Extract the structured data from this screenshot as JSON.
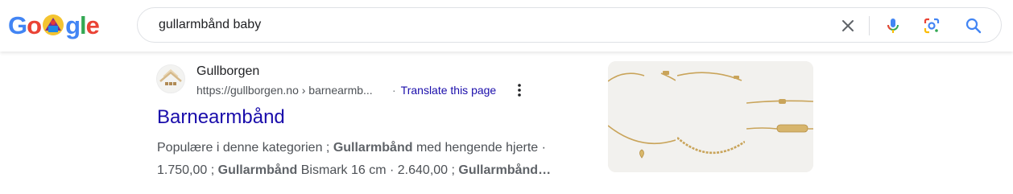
{
  "logo": {
    "alt": "Google"
  },
  "search": {
    "query": "gullarmbånd baby"
  },
  "icons": {
    "clear": "close-icon",
    "mic": "mic-icon",
    "lens": "lens-icon",
    "search": "search-icon",
    "more": "more-vert-icon"
  },
  "result": {
    "site_name": "Gullborgen",
    "url": "https://gullborgen.no › barnearmb...",
    "separator": "·",
    "translate_label": "Translate this page",
    "title": "Barnearmbånd",
    "snippet_line1": [
      {
        "text": "Populære i denne kategorien ; ",
        "bold": false
      },
      {
        "text": "Gullarmbånd",
        "bold": true
      },
      {
        "text": " med hengende hjerte ·",
        "bold": false
      }
    ],
    "snippet_line2": [
      {
        "text": "1.750,00 ; ",
        "bold": false
      },
      {
        "text": "Gullarmbånd",
        "bold": true
      },
      {
        "text": " Bismark 16 cm · 2.640,00 ; ",
        "bold": false
      },
      {
        "text": "Gullarmbånd…",
        "bold": true
      }
    ]
  },
  "colors": {
    "link": "#1a0dab",
    "text": "#202124",
    "muted": "#4d5156",
    "gold": "#c9a45a"
  }
}
